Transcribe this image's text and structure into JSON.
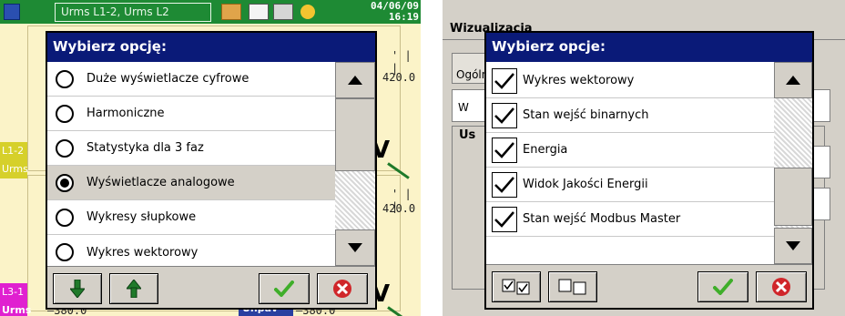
{
  "left": {
    "topbar": {
      "tab_label": "Urms L1-2, Urms L2",
      "date": "04/06/09",
      "time": "16:19"
    },
    "background": {
      "val_upper": "420.0",
      "val_lower": "420.0",
      "side_label_1_line1": "L1-2",
      "side_label_1_line2": "Urms",
      "side_label_2_line1": "L3-1",
      "side_label_2_line2": "Urms",
      "bottom_val_1": "—380.0",
      "bottom_label": "Unpav",
      "bottom_val_2": "—380.0"
    },
    "dialog": {
      "title": "Wybierz opcję:",
      "options": [
        {
          "label": "Duże wyświetlacze cyfrowe",
          "selected": false
        },
        {
          "label": "Harmoniczne",
          "selected": false
        },
        {
          "label": "Statystyka dla 3 faz",
          "selected": false
        },
        {
          "label": "Wyświetlacze analogowe",
          "selected": true
        },
        {
          "label": "Wykresy słupkowe",
          "selected": false
        },
        {
          "label": "Wykres wektorowy",
          "selected": false
        }
      ]
    }
  },
  "right": {
    "background": {
      "window_title": "Wizualizacja",
      "tab_label": "Ogólne",
      "field_prefix": "W",
      "group_label": "Us"
    },
    "dialog": {
      "title": "Wybierz opcje:",
      "options": [
        {
          "label": "Wykres wektorowy",
          "checked": true
        },
        {
          "label": "Stan wejść binarnych",
          "checked": true
        },
        {
          "label": "Energia",
          "checked": true
        },
        {
          "label": "Widok Jakości Energii",
          "checked": true
        },
        {
          "label": "Stan wejść Modbus Master",
          "checked": true
        }
      ]
    }
  },
  "colors": {
    "title_bar": "#0a1a78",
    "status_bar": "#1e8a34",
    "ok_check": "#3fae2a",
    "cancel": "#d0262a",
    "arrow": "#1f7a2a",
    "side_label_1": "#d6d02a",
    "side_label_2": "#e020d0"
  },
  "icons": {
    "move_down": "arrow-down-icon",
    "move_up": "arrow-up-icon",
    "ok": "checkmark-icon",
    "cancel": "cancel-icon",
    "select_all": "select-all-icon",
    "deselect_all": "deselect-all-icon"
  }
}
